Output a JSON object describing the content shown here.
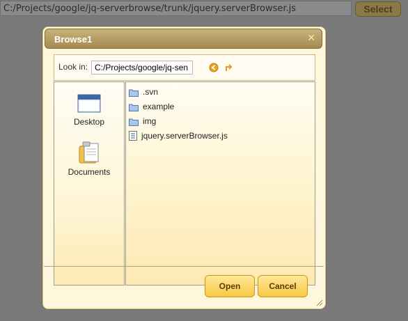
{
  "background": {
    "path_value": "C:/Projects/google/jq-serverbrowse/trunk/jquery.serverBrowser.js",
    "select_label": "Select"
  },
  "dialog": {
    "title": "Browse1",
    "close_icon": "close-icon",
    "lookin": {
      "label": "Look in:",
      "value": "C:/Projects/google/jq-sen"
    },
    "places": [
      {
        "label": "Desktop",
        "icon": "desktop-icon"
      },
      {
        "label": "Documents",
        "icon": "documents-icon"
      }
    ],
    "files": [
      {
        "name": ".svn",
        "type": "folder"
      },
      {
        "name": "example",
        "type": "folder"
      },
      {
        "name": "img",
        "type": "folder"
      },
      {
        "name": "jquery.serverBrowser.js",
        "type": "file"
      }
    ],
    "buttons": {
      "open": "Open",
      "cancel": "Cancel"
    }
  },
  "colors": {
    "overlay": "#7a7a7a",
    "dialog_bg": "#fff7dc",
    "titlebar": "#a48a50",
    "button": "#f6c945"
  }
}
